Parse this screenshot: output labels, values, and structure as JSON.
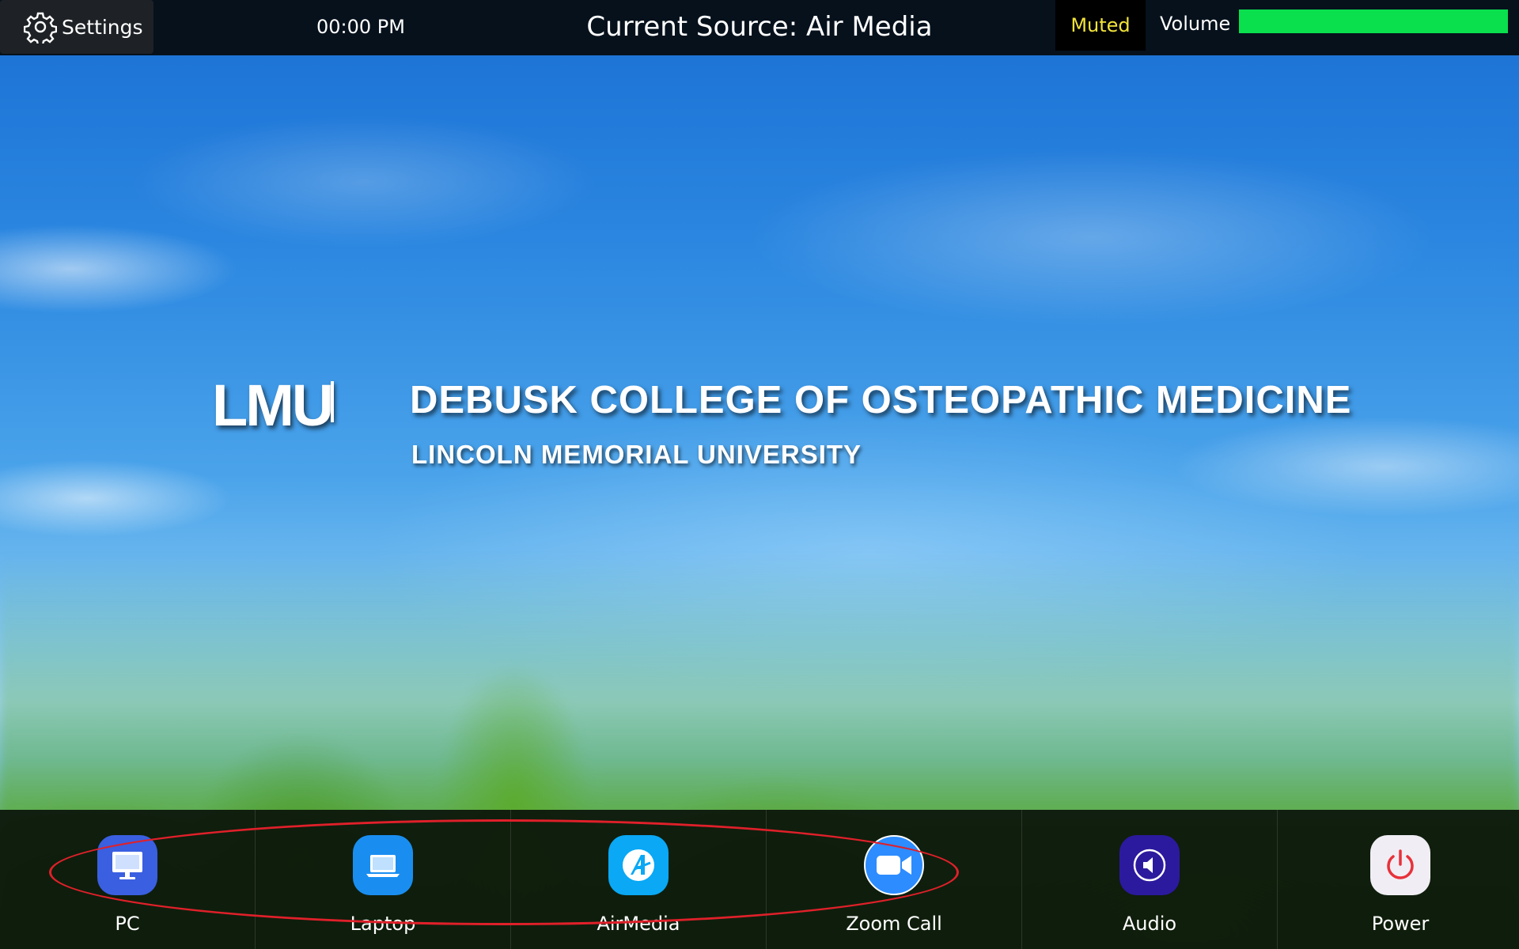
{
  "header": {
    "settings_label": "Settings",
    "clock": "00:00 PM",
    "current_source": "Current Source: Air Media",
    "muted_label": "Muted",
    "volume_label": "Volume",
    "volume_level": 1.0
  },
  "branding": {
    "logo_text": "LMU",
    "college_name": "DEBUSK COLLEGE OF OSTEOPATHIC MEDICINE",
    "university_name": "LINCOLN MEMORIAL UNIVERSITY"
  },
  "dock": {
    "items": [
      {
        "label": "PC",
        "icon": "monitor-icon",
        "color": "#3a5fe0"
      },
      {
        "label": "Laptop",
        "icon": "laptop-icon",
        "color": "#1a8ef0"
      },
      {
        "label": "AirMedia",
        "icon": "airmedia-icon",
        "color": "#0aa8f5"
      },
      {
        "label": "Zoom Call",
        "icon": "video-camera-icon",
        "color": "#2d8cff"
      },
      {
        "label": "Audio",
        "icon": "speaker-icon",
        "color": "#2b1a9e"
      },
      {
        "label": "Power",
        "icon": "power-icon",
        "color": "#f0eef4"
      }
    ]
  },
  "colors": {
    "muted_text": "#f2e33a",
    "volume_fill": "#0adf4e",
    "highlight": "#e0202a",
    "power_symbol": "#e8313a"
  }
}
